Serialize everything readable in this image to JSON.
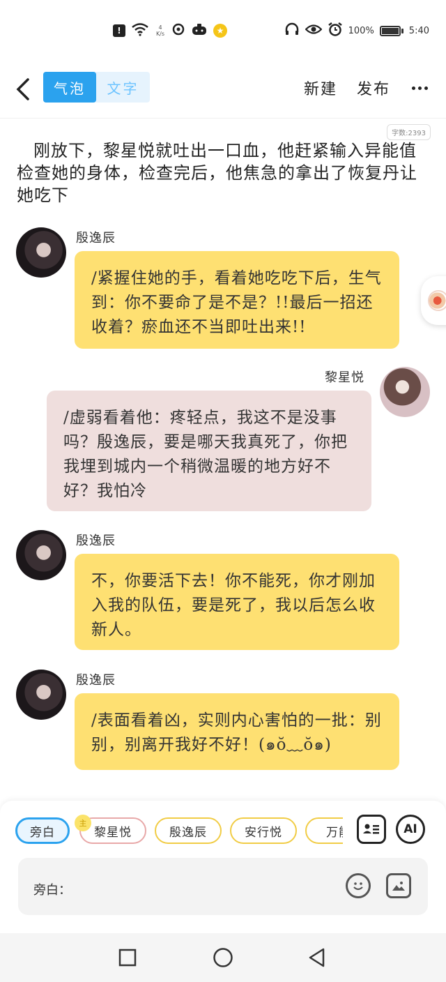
{
  "status_bar": {
    "net_speed_value": "4",
    "net_speed_unit": "K/s",
    "battery_percent": "100%",
    "time": "5:40",
    "icons": [
      "notification-alert-icon",
      "wifi-icon",
      "app-refresh-icon",
      "game-controller-icon",
      "star-badge-icon",
      "headphones-icon",
      "eye-comfort-icon",
      "alarm-icon",
      "battery-icon"
    ]
  },
  "header": {
    "tab_bubble": "气泡",
    "tab_text": "文字",
    "new_label": "新建",
    "publish_label": "发布"
  },
  "content": {
    "word_count": "字数:2393",
    "narration": "刚放下，黎星悦就吐出一口血，他赶紧输入异能值检查她的身体，检查完后，他焦急的拿出了恢复丹让她吃下"
  },
  "messages": [
    {
      "speaker": "殷逸辰",
      "side": "left",
      "text": "/紧握住她的手，看着她吃吃下后，生气到：你不要命了是不是？!!最后一招还收着？瘀血还不当即吐出来!!"
    },
    {
      "speaker": "黎星悦",
      "side": "right",
      "text": "/虚弱看着他：疼轻点，我这不是没事吗？殷逸辰，要是哪天我真死了，你把我埋到城内一个稍微温暖的地方好不好？我怕冷"
    },
    {
      "speaker": "殷逸辰",
      "side": "left",
      "text": "不，你要活下去！你不能死，你才刚加入我的队伍，要是死了，我以后怎么收新人。"
    },
    {
      "speaker": "殷逸辰",
      "side": "left",
      "text": "/表面看着凶，实则内心害怕的一批：别别，别离开我好不好！(๑ŏ﹏ŏ๑)"
    }
  ],
  "role_bar": {
    "chips": [
      "旁白",
      "黎星悦",
      "殷逸辰",
      "安行悦",
      "万能"
    ],
    "selected": "旁白",
    "protagonist_badge": "主",
    "ai_label": "AI"
  },
  "input": {
    "label": "旁白："
  },
  "colors": {
    "accent_blue": "#2ba2ee",
    "bubble_yellow": "#fee072",
    "bubble_pink": "#efdedd"
  }
}
